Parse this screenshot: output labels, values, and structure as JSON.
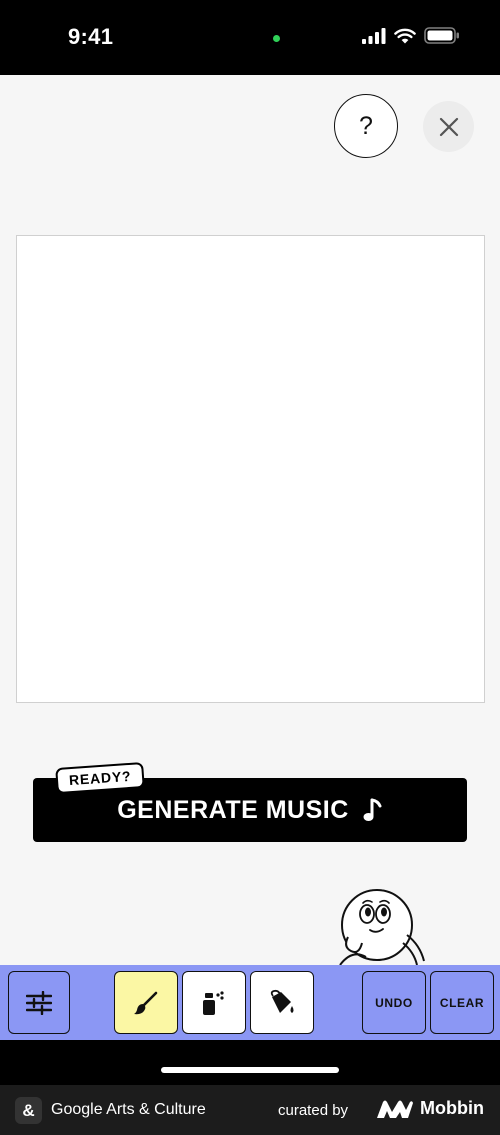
{
  "status_bar": {
    "time": "9:41"
  },
  "header": {
    "help_label": "?"
  },
  "generate": {
    "tag": "READY?",
    "label": "GENERATE MUSIC"
  },
  "toolbar": {
    "active_tool": "brush",
    "undo_label": "UNDO",
    "clear_label": "CLEAR",
    "tools": [
      "settings-sliders",
      "brush",
      "spray",
      "fill-bucket"
    ]
  },
  "footer": {
    "app_icon": "&",
    "app_name": "Google Arts & Culture",
    "curated_label": "curated by",
    "brand": "Mobbin"
  },
  "colors": {
    "toolbar_bg": "#8b97f4",
    "tool_default": "#8b97f4",
    "tool_active": "#fbf7a4",
    "tool_option": "#ffffff",
    "generate_bg": "#000000"
  }
}
